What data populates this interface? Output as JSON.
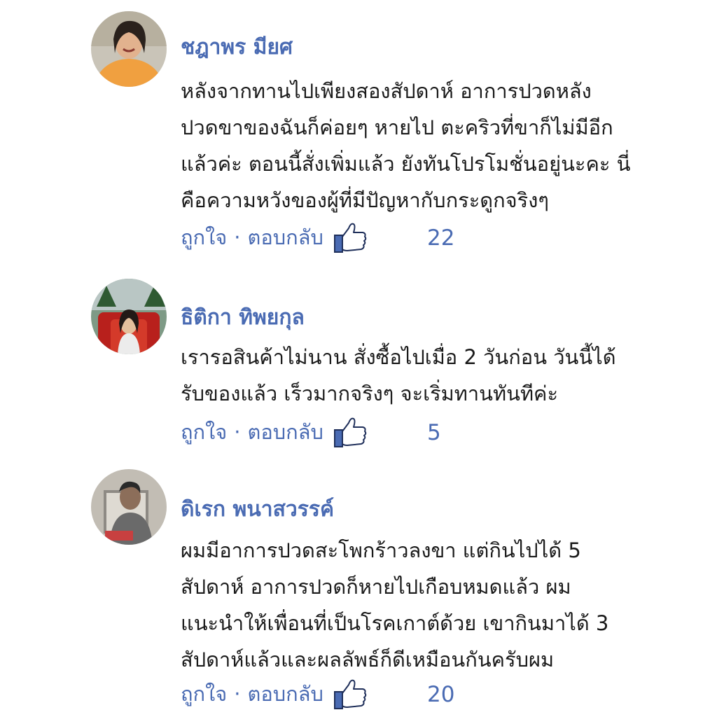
{
  "comments": [
    {
      "name": "ชฎาพร มียศ",
      "lines": [
        "หลังจากทานไปเพียงสองสัปดาห์ อาการปวดหลัง",
        "ปวดขาของฉันก็ค่อยๆ หายไป ตะคริวที่ขาก็ไม่มีอีก",
        "แล้วค่ะ ตอนนี้สั่งเพิ่มแล้ว ยังทันโปรโมชั่นอยู่นะคะ นี่",
        "คือความหวังของผู้ที่มีปัญหากับกระดูกจริงๆ"
      ],
      "like_label": "ถูกใจ",
      "separator": "·",
      "reply_label": "ตอบกลับ",
      "like_count": "22"
    },
    {
      "name": "ธิติกา ทิพยกุล",
      "lines": [
        "เรารอสินค้าไม่นาน สั่งซื้อไปเมื่อ 2 วันก่อน วันนี้ได้",
        "รับของแล้ว เร็วมากจริงๆ จะเริ่มทานทันทีค่ะ"
      ],
      "like_label": "ถูกใจ",
      "separator": "·",
      "reply_label": "ตอบกลับ",
      "like_count": "5"
    },
    {
      "name": "ดิเรก พนาสวรรค์",
      "lines": [
        "ผมมีอาการปวดสะโพกร้าวลงขา แต่กินไปได้ 5",
        "สัปดาห์ อาการปวดก็หายไปเกือบหมดแล้ว ผม",
        "แนะนำให้เพื่อนที่เป็นโรคเกาต์ด้วย เขากินมาได้ 3",
        "สัปดาห์แล้วและผลลัพธ์ก็ดีเหมือนกันครับผม"
      ],
      "like_label": "ถูกใจ",
      "separator": "·",
      "reply_label": "ตอบกลับ",
      "like_count": "20"
    }
  ],
  "colors": {
    "link": "#4a6bb3",
    "text": "#1a1a1a",
    "thumb": "#4a6bb3"
  },
  "icons": {
    "like": "thumbs-up-icon"
  }
}
